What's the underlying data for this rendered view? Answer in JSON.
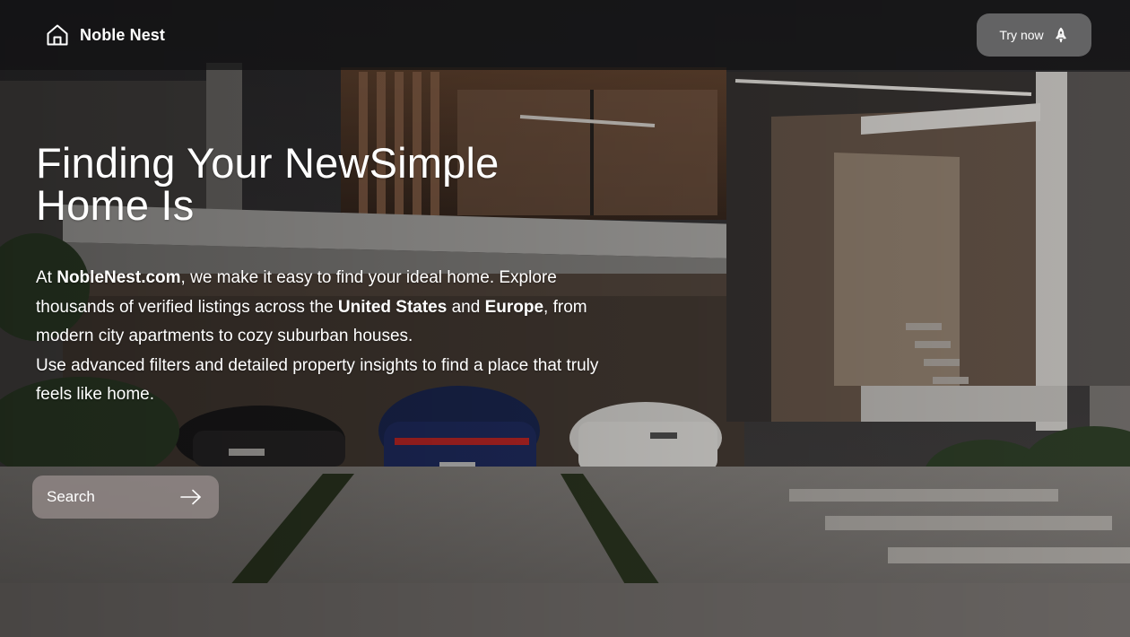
{
  "nav": {
    "brand_name": "Noble Nest",
    "brand_icon": "home-icon",
    "cta_label": "Try now",
    "cta_icon": "rocket-icon"
  },
  "hero": {
    "title_line1": "Finding Your NewSimple",
    "title_line2": "Home Is",
    "desc": {
      "p1_a": "At ",
      "site": "NobleNest.com",
      "p1_b": ", we make it easy to find your ideal home. Explore thousands of verified listings across the ",
      "region1": "United States",
      "p1_c": " and ",
      "region2": "Europe",
      "p1_d": ", from modern city apartments to cozy suburban houses.",
      "p2": "Use advanced filters and detailed property insights to find a place that truly feels like home."
    },
    "search_label": "Search",
    "search_icon": "arrow-right-icon"
  },
  "colors": {
    "topbar_bg": "#121214",
    "cta_bg": "#78787a",
    "search_bg": "#968c8a",
    "text": "#ffffff"
  }
}
